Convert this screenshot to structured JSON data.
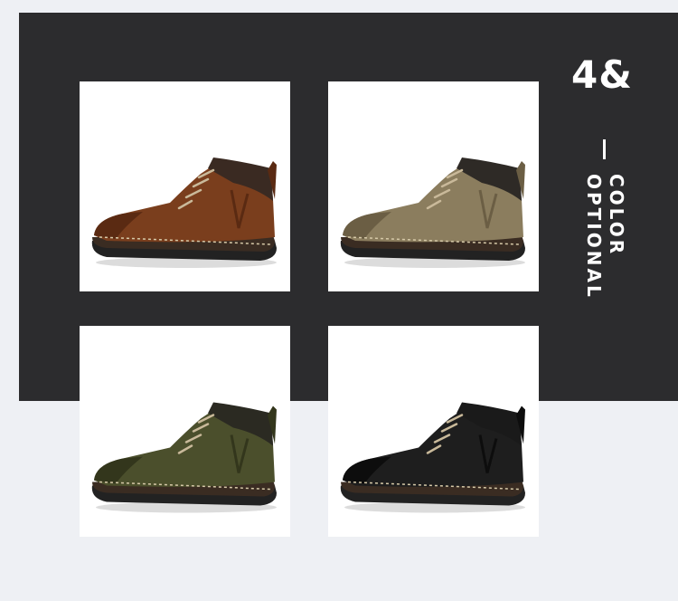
{
  "headline": "4&",
  "subtitle_line1": "COLOR",
  "subtitle_line2": "OPTIONAL",
  "colors": {
    "panel": "#2c2c2e",
    "background": "#eef0f4"
  },
  "products": [
    {
      "name": "brown-boot",
      "upper": "#7a3e1d",
      "upper_dark": "#5a2a12",
      "collar": "#3a2a22"
    },
    {
      "name": "khaki-boot",
      "upper": "#8b7d5e",
      "upper_dark": "#6b5e44",
      "collar": "#2e2a26"
    },
    {
      "name": "olive-boot",
      "upper": "#4b4f2c",
      "upper_dark": "#33361c",
      "collar": "#2b2a22"
    },
    {
      "name": "black-boot",
      "upper": "#1e1e1e",
      "upper_dark": "#0d0d0d",
      "collar": "#1a1a1a"
    }
  ]
}
